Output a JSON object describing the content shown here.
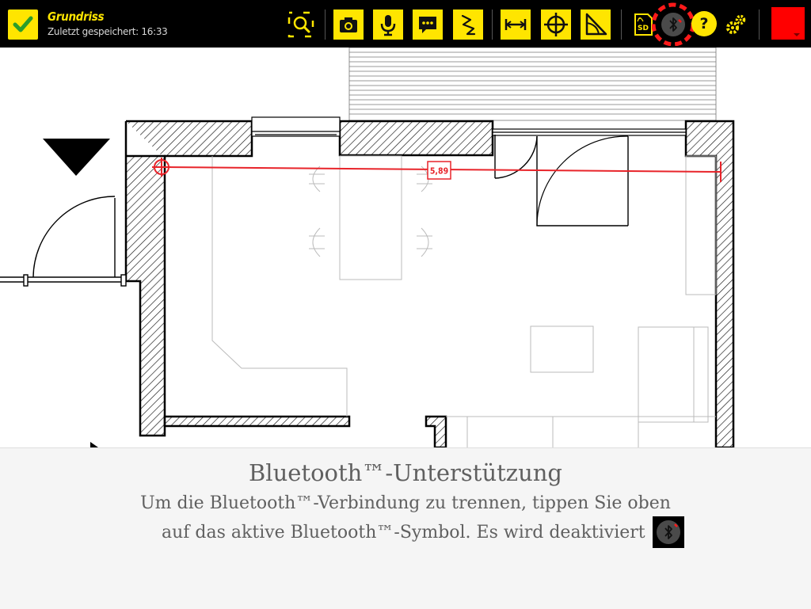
{
  "toolbar": {
    "document_title": "Grundriss",
    "saved_status": "Zuletzt gespeichert: 16:33",
    "buttons": [
      {
        "name": "confirm",
        "icon": "checkmark-icon"
      },
      {
        "name": "zoom-to-fit",
        "icon": "zoom-fit-icon"
      },
      {
        "name": "camera",
        "icon": "camera-icon"
      },
      {
        "name": "microphone",
        "icon": "microphone-icon"
      },
      {
        "name": "comment",
        "icon": "speech-bubble-icon"
      },
      {
        "name": "freehand",
        "icon": "freehand-line-icon"
      },
      {
        "name": "distance",
        "icon": "dimension-line-icon"
      },
      {
        "name": "point",
        "icon": "crosshair-icon"
      },
      {
        "name": "angle",
        "icon": "angle-icon"
      },
      {
        "name": "sd-card",
        "icon": "sd-card-icon"
      },
      {
        "name": "bluetooth",
        "icon": "bluetooth-icon"
      },
      {
        "name": "help",
        "icon": "help-icon"
      },
      {
        "name": "settings",
        "icon": "gears-icon"
      },
      {
        "name": "color",
        "icon": "color-swatch"
      }
    ],
    "sd_label": "SD",
    "help_label": "?",
    "accent_color": "#ffe500",
    "active_color": "#ff0000"
  },
  "floorplan": {
    "measurement_label": "5,89",
    "measurement_color": "#e8242a"
  },
  "hint_panel": {
    "heading": "Bluetooth™-Unterstützung",
    "line1": "Um die Bluetooth™-Verbindung zu trennen, tippen Sie oben",
    "line2": "auf das aktive Bluetooth™-Symbol. Es wird deaktiviert"
  }
}
